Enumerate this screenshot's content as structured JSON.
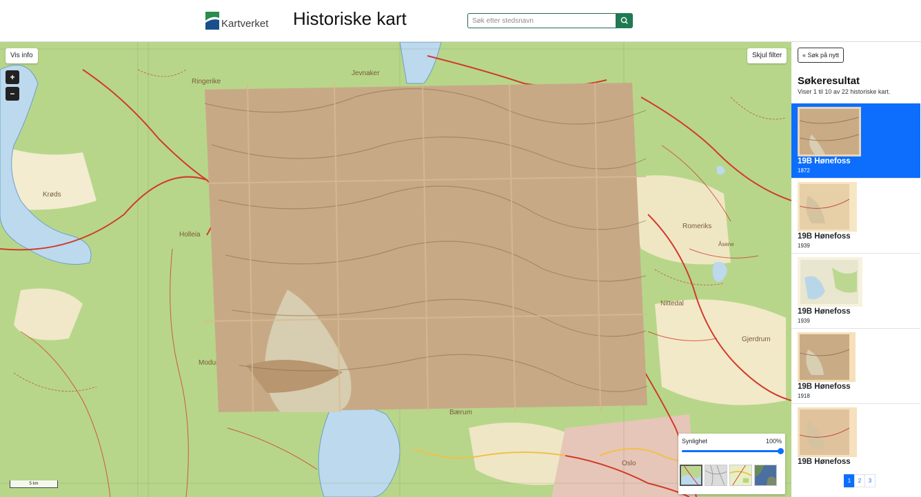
{
  "header": {
    "logo_text": "Kartverket",
    "title": "Historiske kart",
    "search_placeholder": "Søk etter stedsnavn"
  },
  "map": {
    "show_info_label": "Vis info",
    "hide_filter_label": "Skjul filter",
    "zoom_in": "+",
    "zoom_out": "−",
    "scale_label": "5 km",
    "place_labels": [
      "Ringerike",
      "Jevnaker",
      "Krøds",
      "Holleia",
      "Romeriks",
      "Nittedal",
      "Gjerdrum",
      "Bærum",
      "Oslo",
      "Modum",
      "Åsene"
    ],
    "visibility": {
      "label": "Synlighet",
      "value": "100%",
      "level": 1.0
    },
    "colors": {
      "land": "#b9d88a",
      "water": "#bcd9ee",
      "road_red": "#d23a2b",
      "road_yellow": "#f0c04a",
      "overlay": "#c9ab86"
    },
    "layer_icons": [
      "topo-map-icon",
      "grey-map-icon",
      "color-map-icon",
      "satellite-icon"
    ]
  },
  "panel": {
    "back_label": "« Søk på nytt",
    "title": "Søkeresultat",
    "subtitle": "Viser 1 til 10 av 22 historiske kart.",
    "results": [
      {
        "name": "19B Hønefoss",
        "year": "1872",
        "selected": true
      },
      {
        "name": "19B Hønefoss",
        "year": "1939",
        "selected": false
      },
      {
        "name": "19B Hønefoss",
        "year": "1939",
        "selected": false
      },
      {
        "name": "19B Hønefoss",
        "year": "1918",
        "selected": false
      },
      {
        "name": "19B Hønefoss",
        "year": "",
        "selected": false
      }
    ],
    "pages": [
      "1",
      "2",
      "3"
    ],
    "accent": "#0d6efd"
  }
}
